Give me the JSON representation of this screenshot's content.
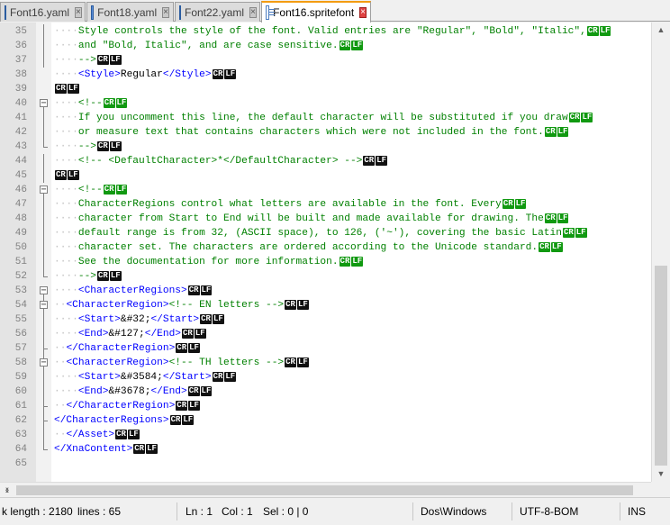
{
  "tabs": [
    {
      "label": "Font16.yaml",
      "active": false
    },
    {
      "label": "Font18.yaml",
      "active": false
    },
    {
      "label": "Font22.yaml",
      "active": false
    },
    {
      "label": "Font16.spritefont",
      "active": true
    }
  ],
  "editor": {
    "eol_cr": "CR",
    "eol_lf": "LF",
    "lines": [
      {
        "n": "35",
        "segs": [
          [
            "g",
            "····"
          ],
          [
            "c",
            "Style controls the style of the font. Valid entries are \"Regular\", \"Bold\", \"Italic\","
          ]
        ],
        "eol": "g"
      },
      {
        "n": "36",
        "segs": [
          [
            "g",
            "····"
          ],
          [
            "c",
            "and \"Bold, Italic\", and are case sensitive."
          ]
        ],
        "eol": "g"
      },
      {
        "n": "37",
        "segs": [
          [
            "g",
            "····"
          ],
          [
            "c",
            "-->"
          ]
        ],
        "eol": "k"
      },
      {
        "n": "38",
        "segs": [
          [
            "g",
            "····"
          ],
          [
            "t",
            "<Style>"
          ],
          [
            "x",
            "Regular"
          ],
          [
            "t",
            "</Style>"
          ]
        ],
        "eol": "k"
      },
      {
        "n": "39",
        "segs": [],
        "eol": "k"
      },
      {
        "n": "40",
        "segs": [
          [
            "g",
            "····"
          ],
          [
            "c",
            "<!--"
          ]
        ],
        "eol": "g"
      },
      {
        "n": "41",
        "segs": [
          [
            "g",
            "····"
          ],
          [
            "c",
            "If you uncomment this line, the default character will be substituted if you draw"
          ]
        ],
        "eol": "g"
      },
      {
        "n": "42",
        "segs": [
          [
            "g",
            "····"
          ],
          [
            "c",
            "or measure text that contains characters which were not included in the font."
          ]
        ],
        "eol": "g"
      },
      {
        "n": "43",
        "segs": [
          [
            "g",
            "····"
          ],
          [
            "c",
            "-->"
          ]
        ],
        "eol": "k"
      },
      {
        "n": "44",
        "segs": [
          [
            "g",
            "····"
          ],
          [
            "c",
            "<!-- <DefaultCharacter>*</DefaultCharacter> -->"
          ]
        ],
        "eol": "k"
      },
      {
        "n": "45",
        "segs": [],
        "eol": "k"
      },
      {
        "n": "46",
        "segs": [
          [
            "g",
            "····"
          ],
          [
            "c",
            "<!--"
          ]
        ],
        "eol": "g"
      },
      {
        "n": "47",
        "segs": [
          [
            "g",
            "····"
          ],
          [
            "c",
            "CharacterRegions control what letters are available in the font. Every"
          ]
        ],
        "eol": "g"
      },
      {
        "n": "48",
        "segs": [
          [
            "g",
            "····"
          ],
          [
            "c",
            "character from Start to End will be built and made available for drawing. The"
          ]
        ],
        "eol": "g"
      },
      {
        "n": "49",
        "segs": [
          [
            "g",
            "····"
          ],
          [
            "c",
            "default range is from 32, (ASCII space), to 126, ('~'), covering the basic Latin"
          ]
        ],
        "eol": "g"
      },
      {
        "n": "50",
        "segs": [
          [
            "g",
            "····"
          ],
          [
            "c",
            "character set. The characters are ordered according to the Unicode standard."
          ]
        ],
        "eol": "g"
      },
      {
        "n": "51",
        "segs": [
          [
            "g",
            "····"
          ],
          [
            "c",
            "See the documentation for more information."
          ]
        ],
        "eol": "g"
      },
      {
        "n": "52",
        "segs": [
          [
            "g",
            "····"
          ],
          [
            "c",
            "-->"
          ]
        ],
        "eol": "k"
      },
      {
        "n": "53",
        "segs": [
          [
            "g",
            "····"
          ],
          [
            "t",
            "<CharacterRegions>"
          ]
        ],
        "eol": "k"
      },
      {
        "n": "54",
        "segs": [
          [
            "g",
            "··"
          ],
          [
            "t",
            "<CharacterRegion>"
          ],
          [
            "c",
            "<!-- EN letters -->"
          ]
        ],
        "eol": "k"
      },
      {
        "n": "55",
        "segs": [
          [
            "g",
            "····"
          ],
          [
            "t",
            "<Start>"
          ],
          [
            "x",
            "&#32;"
          ],
          [
            "t",
            "</Start>"
          ]
        ],
        "eol": "k"
      },
      {
        "n": "56",
        "segs": [
          [
            "g",
            "····"
          ],
          [
            "t",
            "<End>"
          ],
          [
            "x",
            "&#127;"
          ],
          [
            "t",
            "</End>"
          ]
        ],
        "eol": "k"
      },
      {
        "n": "57",
        "segs": [
          [
            "g",
            "··"
          ],
          [
            "t",
            "</CharacterRegion>"
          ]
        ],
        "eol": "k"
      },
      {
        "n": "58",
        "segs": [
          [
            "g",
            "··"
          ],
          [
            "t",
            "<CharacterRegion>"
          ],
          [
            "c",
            "<!-- TH letters -->"
          ]
        ],
        "eol": "k"
      },
      {
        "n": "59",
        "segs": [
          [
            "g",
            "····"
          ],
          [
            "t",
            "<Start>"
          ],
          [
            "x",
            "&#3584;"
          ],
          [
            "t",
            "</Start>"
          ]
        ],
        "eol": "k"
      },
      {
        "n": "60",
        "segs": [
          [
            "g",
            "····"
          ],
          [
            "t",
            "<End>"
          ],
          [
            "x",
            "&#3678;"
          ],
          [
            "t",
            "</End>"
          ]
        ],
        "eol": "k"
      },
      {
        "n": "61",
        "segs": [
          [
            "g",
            "··"
          ],
          [
            "t",
            "</CharacterRegion>"
          ]
        ],
        "eol": "k"
      },
      {
        "n": "62",
        "segs": [
          [
            "t",
            "</CharacterRegions>"
          ]
        ],
        "eol": "k"
      },
      {
        "n": "63",
        "segs": [
          [
            "g",
            "··"
          ],
          [
            "t",
            "</Asset>"
          ]
        ],
        "eol": "k"
      },
      {
        "n": "64",
        "segs": [
          [
            "t",
            "</XnaContent>"
          ]
        ],
        "eol": "k"
      },
      {
        "n": "65",
        "segs": [],
        "eol": ""
      }
    ]
  },
  "status": {
    "length": "k length : 2180",
    "lines": "lines : 65",
    "ln": "Ln : 1",
    "col": "Col : 1",
    "sel": "Sel : 0 | 0",
    "eol_format": "Dos\\Windows",
    "encoding": "UTF-8-BOM",
    "mode": "INS"
  }
}
